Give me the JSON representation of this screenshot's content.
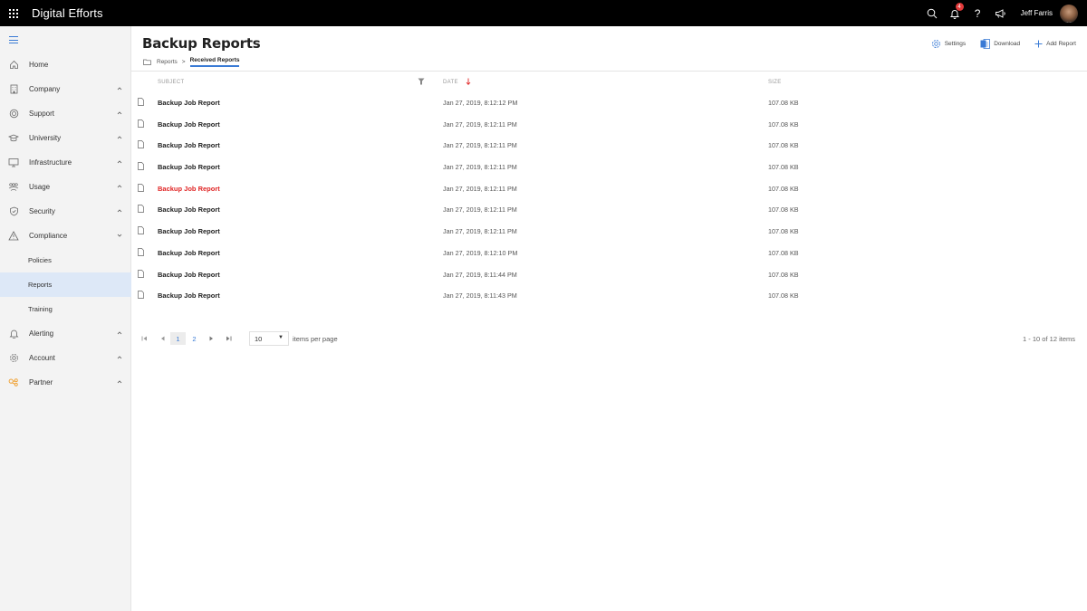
{
  "app": {
    "title": "Digital Efforts",
    "notification_count": "4",
    "user_name": "Jeff Farris"
  },
  "topbar_icons": [
    "waffle-icon",
    "search-icon",
    "bell-icon",
    "help-icon",
    "megaphone-icon",
    "avatar"
  ],
  "sidebar": {
    "items": [
      {
        "label": "Home",
        "icon": "home-icon",
        "chevron": ""
      },
      {
        "label": "Company",
        "icon": "building-icon",
        "chevron": "up"
      },
      {
        "label": "Support",
        "icon": "support-icon",
        "chevron": "up"
      },
      {
        "label": "University",
        "icon": "graduation-cap-icon",
        "chevron": "up"
      },
      {
        "label": "Infrastructure",
        "icon": "monitor-icon",
        "chevron": "up"
      },
      {
        "label": "Usage",
        "icon": "people-icon",
        "chevron": "up"
      },
      {
        "label": "Security",
        "icon": "shield-icon",
        "chevron": "up"
      },
      {
        "label": "Compliance",
        "icon": "warning-icon",
        "chevron": "down"
      }
    ],
    "compliance_sub": [
      {
        "label": "Policies",
        "active": false
      },
      {
        "label": "Reports",
        "active": true
      },
      {
        "label": "Training",
        "active": false
      }
    ],
    "items_after": [
      {
        "label": "Alerting",
        "icon": "bell-icon",
        "chevron": "up"
      },
      {
        "label": "Account",
        "icon": "gear-icon",
        "chevron": "up"
      },
      {
        "label": "Partner",
        "icon": "partner-icon",
        "chevron": "up",
        "color": "#f0a030"
      }
    ]
  },
  "page": {
    "title": "Backup Reports",
    "breadcrumb": [
      "Reports",
      "Received Reports"
    ],
    "breadcrumb_separator": ">",
    "actions": {
      "settings": "Settings",
      "download": "Download",
      "add_report": "Add Report"
    }
  },
  "table": {
    "columns": {
      "subject": "SUBJECT",
      "date": "DATE",
      "size": "SIZE"
    },
    "sort": {
      "column": "date",
      "direction": "descending",
      "color": "#e02424"
    },
    "rows": [
      {
        "subject": "Backup Job Report",
        "date": "Jan 27, 2019, 8:12:12 PM",
        "size": "107.08 KB",
        "highlight": false
      },
      {
        "subject": "Backup Job Report",
        "date": "Jan 27, 2019, 8:12:11 PM",
        "size": "107.08 KB",
        "highlight": false
      },
      {
        "subject": "Backup Job Report",
        "date": "Jan 27, 2019, 8:12:11 PM",
        "size": "107.08 KB",
        "highlight": false
      },
      {
        "subject": "Backup Job Report",
        "date": "Jan 27, 2019, 8:12:11 PM",
        "size": "107.08 KB",
        "highlight": false
      },
      {
        "subject": "Backup Job Report",
        "date": "Jan 27, 2019, 8:12:11 PM",
        "size": "107.08 KB",
        "highlight": true
      },
      {
        "subject": "Backup Job Report",
        "date": "Jan 27, 2019, 8:12:11 PM",
        "size": "107.08 KB",
        "highlight": false
      },
      {
        "subject": "Backup Job Report",
        "date": "Jan 27, 2019, 8:12:11 PM",
        "size": "107.08 KB",
        "highlight": false
      },
      {
        "subject": "Backup Job Report",
        "date": "Jan 27, 2019, 8:12:10 PM",
        "size": "107.08 KB",
        "highlight": false
      },
      {
        "subject": "Backup Job Report",
        "date": "Jan 27, 2019, 8:11:44 PM",
        "size": "107.08 KB",
        "highlight": false
      },
      {
        "subject": "Backup Job Report",
        "date": "Jan 27, 2019, 8:11:43 PM",
        "size": "107.08 KB",
        "highlight": false
      }
    ]
  },
  "pagination": {
    "pages": [
      "1",
      "2"
    ],
    "current_page": "1",
    "page_size": "10",
    "page_size_label": "items per page",
    "info": "1 - 10 of 12 items"
  },
  "colors": {
    "accent": "#3a7bd5",
    "highlight_text": "#e02424",
    "active_nav_bg": "#dde8f7",
    "topbar_bg": "#000000",
    "badge": "#e23a3a"
  }
}
